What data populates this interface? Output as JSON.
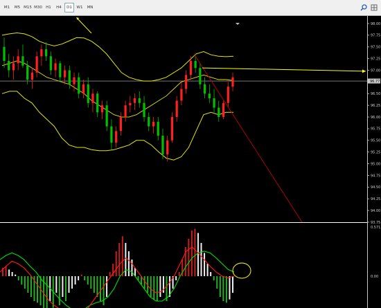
{
  "toolbar": {
    "timeframes": [
      "M1",
      "M5",
      "M15",
      "M30",
      "H1",
      "H4",
      "D1",
      "W1",
      "MN"
    ],
    "active": "D1",
    "icons": [
      "search-icon",
      "chart-grid-icon"
    ]
  },
  "price_axis": {
    "labels": [
      "98.00",
      "97.75",
      "97.50",
      "97.25",
      "97.00",
      "96.75",
      "96.50",
      "96.25",
      "96.00",
      "95.75",
      "95.50",
      "95.25",
      "95.00",
      "94.75",
      "94.50",
      "94.25",
      "94.00",
      "93.75"
    ],
    "current": "96.77"
  },
  "indicator_axis": {
    "top": "0.5713",
    "zero": "0.00"
  },
  "colors": {
    "background": "#000000",
    "bull": "#ff2020",
    "bear": "#00c000",
    "bands": "#e6e600",
    "trendline": "#c00000",
    "annotation": "#ffff00",
    "hist_pos": "#c81e1e",
    "hist_neg": "#22b222",
    "hist_light": "#eeeeee",
    "signal_fast": "#00e000",
    "signal_slow": "#ff1a1a"
  },
  "chart_data": {
    "type": "candlestick",
    "ylim": [
      93.75,
      98.0
    ],
    "candles": [
      [
        97.5,
        97.7,
        97.05,
        97.2
      ],
      [
        97.2,
        97.35,
        96.85,
        97.0
      ],
      [
        97.0,
        97.3,
        96.8,
        97.15
      ],
      [
        97.15,
        97.45,
        97.0,
        97.3
      ],
      [
        97.3,
        97.55,
        97.05,
        97.1
      ],
      [
        97.1,
        97.2,
        96.7,
        96.8
      ],
      [
        96.8,
        97.05,
        96.6,
        96.95
      ],
      [
        96.95,
        97.4,
        96.85,
        97.3
      ],
      [
        97.3,
        97.55,
        97.1,
        97.45
      ],
      [
        97.45,
        97.6,
        97.2,
        97.3
      ],
      [
        97.3,
        97.4,
        96.9,
        97.0
      ],
      [
        97.0,
        97.25,
        96.85,
        97.15
      ],
      [
        97.15,
        97.2,
        96.75,
        96.85
      ],
      [
        96.85,
        97.1,
        96.7,
        97.0
      ],
      [
        97.0,
        97.1,
        96.6,
        96.7
      ],
      [
        96.7,
        96.95,
        96.55,
        96.85
      ],
      [
        96.85,
        96.95,
        96.4,
        96.5
      ],
      [
        96.5,
        96.8,
        96.4,
        96.7
      ],
      [
        96.7,
        96.85,
        96.2,
        96.3
      ],
      [
        96.3,
        96.6,
        96.1,
        96.5
      ],
      [
        96.5,
        96.55,
        96.0,
        96.1
      ],
      [
        96.1,
        96.35,
        95.95,
        96.25
      ],
      [
        96.25,
        96.35,
        95.7,
        95.8
      ],
      [
        95.8,
        95.95,
        95.3,
        95.45
      ],
      [
        95.45,
        95.8,
        95.35,
        95.7
      ],
      [
        95.7,
        96.1,
        95.6,
        96.0
      ],
      [
        96.0,
        96.35,
        95.9,
        96.25
      ],
      [
        96.25,
        96.45,
        96.1,
        96.3
      ],
      [
        96.3,
        96.5,
        96.15,
        96.4
      ],
      [
        96.4,
        96.55,
        96.2,
        96.3
      ],
      [
        96.3,
        96.45,
        95.9,
        96.0
      ],
      [
        96.0,
        96.1,
        95.7,
        95.8
      ],
      [
        95.8,
        96.0,
        95.65,
        95.9
      ],
      [
        95.9,
        96.0,
        95.5,
        95.6
      ],
      [
        95.6,
        95.75,
        95.1,
        95.2
      ],
      [
        95.2,
        95.6,
        95.05,
        95.5
      ],
      [
        95.5,
        96.1,
        95.45,
        96.0
      ],
      [
        96.0,
        96.45,
        95.9,
        96.35
      ],
      [
        96.35,
        96.75,
        96.25,
        96.6
      ],
      [
        96.6,
        97.0,
        96.5,
        96.9
      ],
      [
        96.9,
        97.3,
        96.8,
        97.2
      ],
      [
        97.2,
        97.35,
        96.95,
        97.05
      ],
      [
        97.05,
        97.15,
        96.6,
        96.7
      ],
      [
        96.7,
        96.85,
        96.4,
        96.5
      ],
      [
        96.5,
        96.7,
        96.3,
        96.4
      ],
      [
        96.4,
        96.6,
        96.1,
        96.2
      ],
      [
        96.2,
        96.35,
        95.9,
        96.0
      ],
      [
        96.0,
        96.35,
        95.95,
        96.3
      ],
      [
        96.3,
        96.75,
        96.2,
        96.65
      ],
      [
        96.65,
        96.95,
        96.55,
        96.85
      ]
    ],
    "upper_band": [
      97.75,
      97.78,
      97.8,
      97.78,
      97.72,
      97.62,
      97.56,
      97.52,
      97.56,
      97.63,
      97.7,
      97.69,
      97.62,
      97.5,
      97.35,
      97.15,
      96.95,
      96.85,
      96.8,
      96.77,
      96.77,
      96.8,
      96.85,
      96.95,
      97.05,
      97.2,
      97.35,
      97.4,
      97.33,
      97.3,
      97.29,
      97.3
    ],
    "middle_band": [
      97.1,
      97.15,
      97.2,
      97.15,
      97.05,
      96.95,
      96.85,
      96.8,
      96.75,
      96.7,
      96.6,
      96.5,
      96.35,
      96.25,
      96.15,
      96.05,
      96.0,
      96.0,
      96.05,
      96.15,
      96.25,
      96.35,
      96.45,
      96.6,
      96.75,
      96.8,
      96.85,
      96.9,
      96.85,
      96.8,
      96.8,
      96.78
    ],
    "lower_band": [
      96.5,
      96.55,
      96.55,
      96.4,
      96.3,
      96.1,
      95.95,
      95.8,
      95.55,
      95.4,
      95.35,
      95.35,
      95.3,
      95.28,
      95.28,
      95.3,
      95.35,
      95.4,
      95.5,
      95.5,
      95.4,
      95.25,
      95.12,
      95.08,
      95.15,
      95.35,
      95.7,
      96.05,
      96.1,
      96.05,
      96.1,
      96.1
    ],
    "histogram": [
      0.1,
      0.12,
      0.08,
      0.05,
      0.02,
      -0.05,
      -0.1,
      -0.15,
      -0.2,
      -0.25,
      -0.3,
      -0.32,
      -0.35,
      -0.4,
      -0.42,
      -0.3,
      -0.38,
      -0.2,
      -0.35,
      -0.25,
      -0.3,
      -0.2,
      -0.15,
      -0.1,
      -0.05,
      0.02,
      -0.05,
      -0.1,
      -0.15,
      -0.2,
      -0.25,
      -0.3,
      -0.35,
      -0.25,
      0.05,
      0.15,
      0.3,
      0.4,
      0.48,
      0.4,
      0.3,
      0.2,
      0.1,
      -0.05,
      -0.1,
      -0.15,
      -0.2,
      -0.25,
      -0.28,
      -0.3,
      -0.25,
      -0.2,
      -0.3,
      -0.25,
      -0.15,
      -0.05,
      0.05,
      0.2,
      0.35,
      0.45,
      0.55,
      0.57,
      0.52,
      0.4,
      0.28,
      0.15,
      0.05,
      -0.05,
      -0.15,
      -0.25,
      -0.3,
      -0.32,
      -0.28,
      -0.2
    ],
    "signal_fast": [
      0.2,
      0.25,
      0.28,
      0.25,
      0.2,
      0.12,
      0.05,
      -0.05,
      -0.12,
      -0.2,
      -0.28,
      -0.35,
      -0.4,
      -0.42,
      -0.4,
      -0.35,
      -0.32,
      -0.3,
      -0.25,
      -0.15,
      0.0,
      0.08,
      0.05,
      -0.05,
      -0.15,
      -0.25,
      -0.3,
      -0.3,
      -0.25,
      -0.15,
      0.0,
      0.12,
      0.22,
      0.28,
      0.3,
      0.28,
      0.22,
      0.15,
      0.08,
      0.05
    ],
    "signal_slow": [
      0.05,
      0.12,
      0.18,
      0.15,
      0.1,
      0.02,
      -0.08,
      -0.18,
      -0.28,
      -0.35,
      -0.4,
      -0.45,
      -0.48,
      -0.5,
      -0.45,
      -0.35,
      -0.25,
      -0.15,
      -0.05,
      0.05,
      0.15,
      0.22,
      0.15,
      0.05,
      -0.05,
      -0.15,
      -0.2,
      -0.18,
      -0.1,
      0.0,
      0.15,
      0.3,
      0.35,
      0.28,
      0.2,
      0.12,
      0.05,
      0.0,
      -0.02,
      0.0
    ]
  }
}
